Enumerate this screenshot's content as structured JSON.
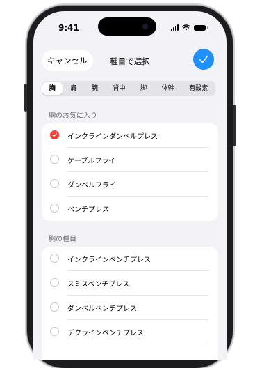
{
  "status_bar": {
    "time": "9:41",
    "icons": [
      "signal-icon",
      "wifi-icon",
      "battery-icon"
    ]
  },
  "header": {
    "cancel_label": "キャンセル",
    "title": "種目で選択",
    "confirm_icon": "checkmark-icon"
  },
  "segments": [
    {
      "label": "胸",
      "selected": true
    },
    {
      "label": "肩",
      "selected": false
    },
    {
      "label": "腕",
      "selected": false
    },
    {
      "label": "背中",
      "selected": false
    },
    {
      "label": "脚",
      "selected": false
    },
    {
      "label": "体幹",
      "selected": false
    },
    {
      "label": "有酸素",
      "selected": false
    }
  ],
  "favorites": {
    "title": "胸のお気に入り",
    "items": [
      {
        "label": "インクラインダンベルプレス",
        "checked": true
      },
      {
        "label": "ケーブルフライ",
        "checked": false
      },
      {
        "label": "ダンベルフライ",
        "checked": false
      },
      {
        "label": "ベンチプレス",
        "checked": false
      }
    ]
  },
  "exercises": {
    "title": "胸の種目",
    "items": [
      {
        "label": "インクラインベンチプレス",
        "checked": false
      },
      {
        "label": "スミスベンチプレス",
        "checked": false
      },
      {
        "label": "ダンベルベンチプレス",
        "checked": false
      },
      {
        "label": "デクラインベンチプレス",
        "checked": false
      }
    ]
  },
  "colors": {
    "accent": "#1e90ff",
    "checked": "#ff3b30",
    "background": "#f2f2f7"
  }
}
